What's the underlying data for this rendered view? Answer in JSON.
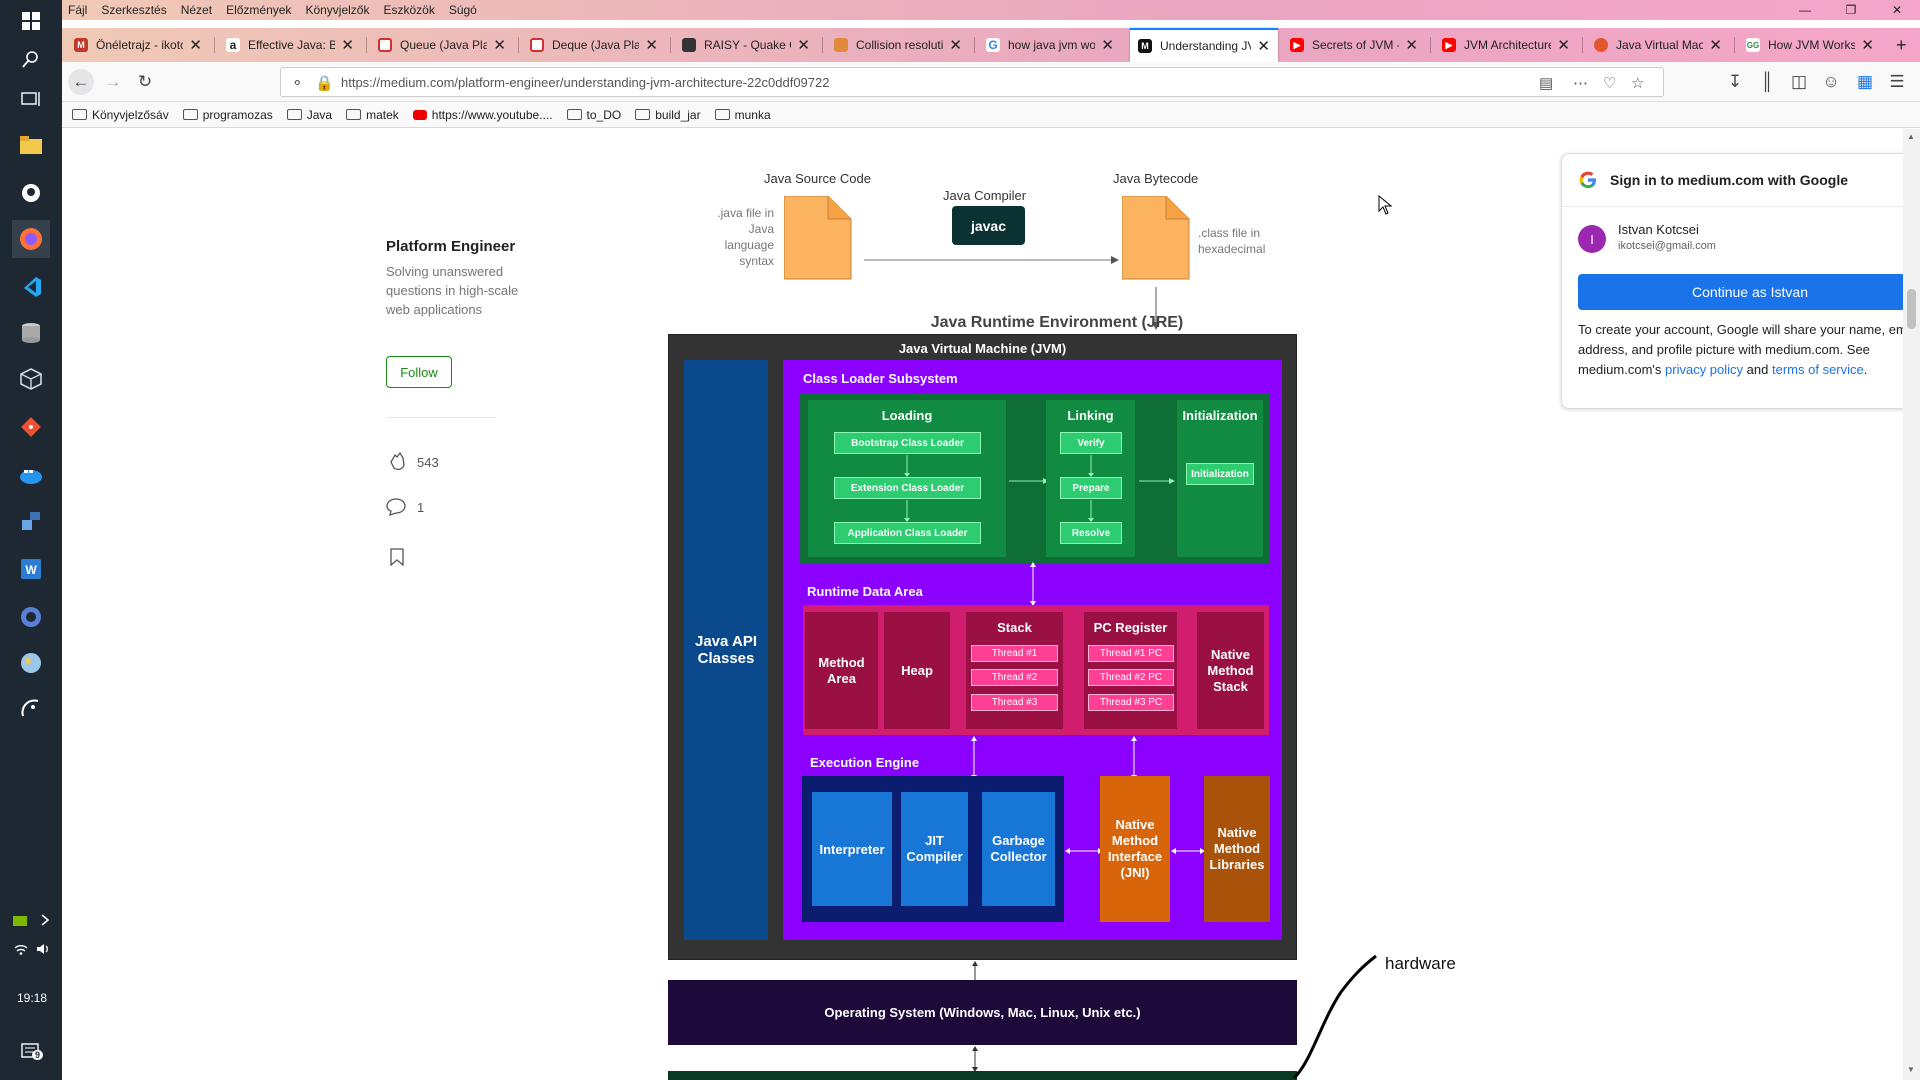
{
  "menubar": {
    "items": [
      "Fájl",
      "Szerkesztés",
      "Nézet",
      "Előzmények",
      "Könyvjelzők",
      "Eszközök",
      "Súgó"
    ]
  },
  "tabs": [
    {
      "label": "Önéletrajz - ikotc",
      "color": "#c0392b",
      "glyph": "M"
    },
    {
      "label": "Effective Java: Bl",
      "color": "#222",
      "glyph": "a"
    },
    {
      "label": "Queue (Java Platf",
      "color": "#d32f2f",
      "glyph": ""
    },
    {
      "label": "Deque (Java Platf",
      "color": "#d32f2f",
      "glyph": ""
    },
    {
      "label": "RAISY - Quake C",
      "color": "#333",
      "glyph": ""
    },
    {
      "label": "Collision resolutio",
      "color": "#e08a3c",
      "glyph": ""
    },
    {
      "label": "how java jvm wo",
      "color": "#4285f4",
      "glyph": "G"
    },
    {
      "label": "Understanding JV",
      "color": "#111",
      "glyph": "M"
    },
    {
      "label": "Secrets of JVM - I",
      "color": "#f00",
      "glyph": ""
    },
    {
      "label": "JVM Architecture",
      "color": "#f00",
      "glyph": ""
    },
    {
      "label": "Java Virtual Mach",
      "color": "#e4572e",
      "glyph": ""
    },
    {
      "label": "How JVM Works",
      "color": "#555",
      "glyph": "GG"
    }
  ],
  "navbar": {
    "url": "https://medium.com/platform-engineer/understanding-jvm-architecture-22c0ddf09722"
  },
  "bookmarks": [
    {
      "label": "Könyvjelzősáv",
      "type": "folder"
    },
    {
      "label": "programozas",
      "type": "folder"
    },
    {
      "label": "Java",
      "type": "folder"
    },
    {
      "label": "matek",
      "type": "folder"
    },
    {
      "label": "https://www.youtube....",
      "type": "youtube"
    },
    {
      "label": "to_DO",
      "type": "folder"
    },
    {
      "label": "build_jar",
      "type": "folder"
    },
    {
      "label": "munka",
      "type": "folder"
    }
  ],
  "sidebar": {
    "publication": "Platform Engineer",
    "description": "Solving unanswered questions in high-scale web applications",
    "follow": "Follow",
    "claps": "543",
    "comments": "1"
  },
  "diagram": {
    "source_title": "Java Source Code",
    "source_desc": ".java file in Java language syntax",
    "compiler_title": "Java Compiler",
    "compiler_name": "javac",
    "bytecode_title": "Java Bytecode",
    "bytecode_desc": ".class file in hexadecimal",
    "jre": "Java Runtime Environment (JRE)",
    "jvm": "Java Virtual Machine (JVM)",
    "api": "Java API Classes",
    "classloader": "Class Loader Subsystem",
    "loading": "Loading",
    "bootstrap": "Bootstrap Class Loader",
    "extension": "Extension Class Loader",
    "application": "Application Class Loader",
    "linking": "Linking",
    "verify": "Verify",
    "prepare": "Prepare",
    "resolve": "Resolve",
    "initialization": "Initialization",
    "initialization_box": "Initialization",
    "runtime": "Runtime Data Area",
    "method_area": "Method Area",
    "heap": "Heap",
    "stack": "Stack",
    "threads": [
      "Thread #1",
      "Thread #2",
      "Thread #3"
    ],
    "pc": "PC Register",
    "pc_threads": [
      "Thread #1 PC",
      "Thread #2 PC",
      "Thread #3 PC"
    ],
    "native_stack": "Native Method Stack",
    "exec": "Execution Engine",
    "interpreter": "Interpreter",
    "jit": "JIT Compiler",
    "gc": "Garbage Collector",
    "jni": "Native Method Interface (JNI)",
    "libs": "Native Method Libraries",
    "os": "Operating System (Windows, Mac, Linux, Unix etc.)",
    "hardware": "hardware"
  },
  "popup": {
    "title": "Sign in to medium.com with Google",
    "initial": "I",
    "name": "Istvan Kotcsei",
    "email": "ikotcsei@gmail.com",
    "button": "Continue as Istvan",
    "text": "To create your account, Google will share your name, email address, and profile picture with medium.com. See medium.com's",
    "privacy": "privacy policy",
    "and": "and",
    "terms": "terms of service",
    "period": "."
  },
  "taskbar": {
    "time": "19:18",
    "badge": "9"
  }
}
